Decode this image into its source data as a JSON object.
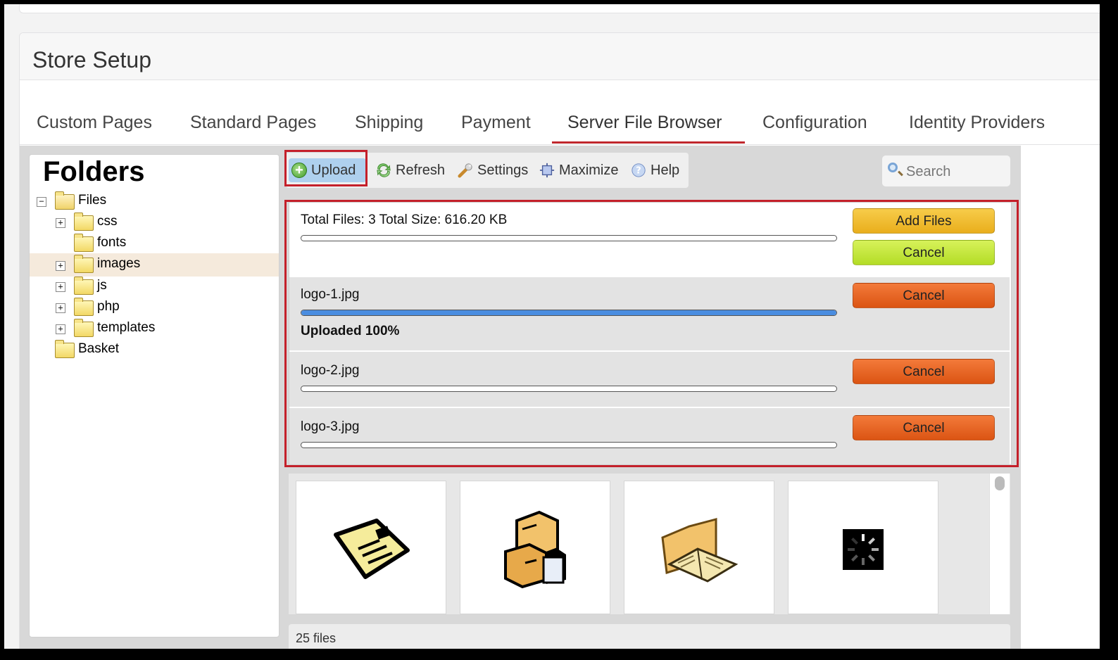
{
  "page": {
    "title": "Store Setup"
  },
  "tabs": [
    {
      "label": "Custom Pages"
    },
    {
      "label": "Standard Pages"
    },
    {
      "label": "Shipping"
    },
    {
      "label": "Payment"
    },
    {
      "label": "Server File Browser",
      "active": true
    },
    {
      "label": "Configuration"
    },
    {
      "label": "Identity Providers"
    }
  ],
  "folders": {
    "title": "Folders",
    "items": [
      {
        "label": "Files",
        "expander": "−"
      },
      {
        "label": "css",
        "expander": "+"
      },
      {
        "label": "fonts"
      },
      {
        "label": "images",
        "expander": "+",
        "selected": true
      },
      {
        "label": "js",
        "expander": "+"
      },
      {
        "label": "php",
        "expander": "+"
      },
      {
        "label": "templates",
        "expander": "+"
      },
      {
        "label": "Basket"
      }
    ]
  },
  "toolbar": {
    "upload": "Upload",
    "refresh": "Refresh",
    "settings": "Settings",
    "maximize": "Maximize",
    "help": "Help",
    "search_placeholder": "Search"
  },
  "upload": {
    "summary": "Total Files: 3 Total Size: 616.20 KB",
    "add_files": "Add Files",
    "cancel_all": "Cancel",
    "files": [
      {
        "name": "logo-1.jpg",
        "progress": 1.0,
        "status": "Uploaded 100%",
        "cancel": "Cancel"
      },
      {
        "name": "logo-2.jpg",
        "progress": 0,
        "cancel": "Cancel"
      },
      {
        "name": "logo-3.jpg",
        "progress": 0,
        "cancel": "Cancel"
      }
    ]
  },
  "thumbnails": [
    {
      "icon": "envelope-icon"
    },
    {
      "icon": "boxes-icon"
    },
    {
      "icon": "folder-book-icon"
    },
    {
      "icon": "loading-spinner-icon"
    }
  ],
  "footer": {
    "file_count": "25 files"
  },
  "colors": {
    "accent_red": "#c4202a",
    "progress_blue": "#4a8de0",
    "add_files": "#f0bd31",
    "cancel_all": "#c6e63f",
    "cancel": "#e86526"
  }
}
